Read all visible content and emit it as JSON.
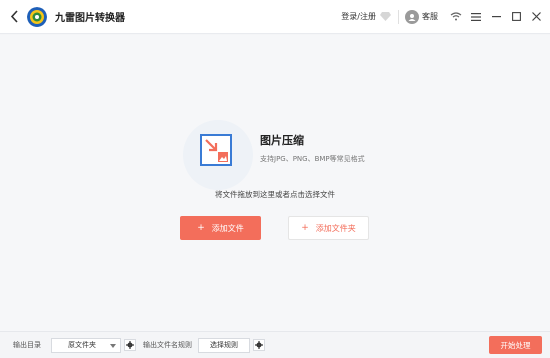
{
  "app": {
    "title": "九雷图片转换器"
  },
  "header": {
    "login_label": "登录/注册",
    "support_label": "客服"
  },
  "main": {
    "feature_title": "图片压缩",
    "feature_subtitle": "支持JPG、PNG、BMP等常见格式",
    "drop_hint": "将文件拖放到这里或者点击选择文件",
    "add_file_label": "添加文件",
    "add_folder_label": "添加文件夹"
  },
  "footer": {
    "output_dir_label": "输出目录",
    "output_dir_value": "原文件夹",
    "output_name_rule_label": "输出文件名规则",
    "select_rule_label": "选择规则",
    "start_label": "开始处理"
  },
  "colors": {
    "accent": "#f36e5b",
    "icon_blue": "#3a7bd5"
  }
}
